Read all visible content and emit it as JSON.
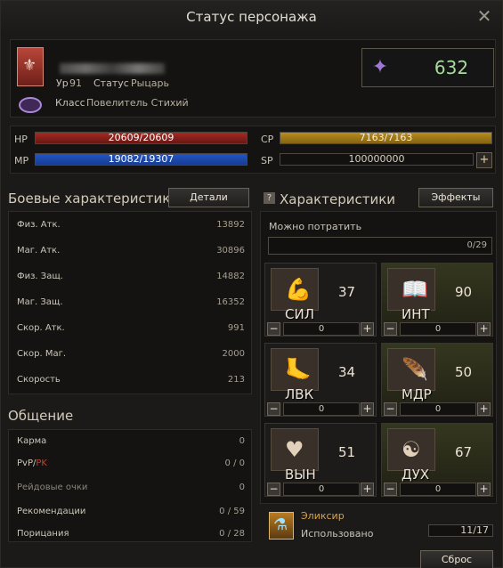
{
  "window": {
    "title": "Статус персонажа"
  },
  "profile": {
    "level_label": "Ур",
    "level_value": "91",
    "status_label": "Статус",
    "status_value": "Рыцарь",
    "class_label": "Класс",
    "class_value": "Повелитель Стихий",
    "cp_power": "632"
  },
  "bars": {
    "hp_label": "HP",
    "hp_value": "20609/20609",
    "mp_label": "MP",
    "mp_value": "19082/19307",
    "cp_label": "CP",
    "cp_value": "7163/7163",
    "sp_label": "SP",
    "sp_value": "100000000"
  },
  "combat": {
    "title": "Боевые характеристики",
    "details_button": "Детали",
    "rows": [
      {
        "name": "Физ. Атк.",
        "value": "13892"
      },
      {
        "name": "Маг. Атк.",
        "value": "30896"
      },
      {
        "name": "Физ. Защ.",
        "value": "14882"
      },
      {
        "name": "Маг. Защ.",
        "value": "16352"
      },
      {
        "name": "Скор. Атк.",
        "value": "991"
      },
      {
        "name": "Скор. Маг.",
        "value": "2000"
      },
      {
        "name": "Скорость",
        "value": "213"
      }
    ]
  },
  "social": {
    "title": "Общение",
    "karma_label": "Карма",
    "karma_value": "0",
    "pvp_label": "PvP/",
    "pk_label": "PK",
    "pvp_value": "0 / 0",
    "raid_label": "Рейдовые очки",
    "raid_value": "0",
    "recommend_label": "Рекомендации",
    "recommend_value": "0 / 59",
    "censure_label": "Порицания",
    "censure_value": "0 / 28"
  },
  "characteristics": {
    "title": "Характеристики",
    "effects_button": "Эффекты",
    "spend_label": "Можно потратить",
    "spend_value": "0/29",
    "stats": [
      {
        "name": "СИЛ",
        "value": "37",
        "input": "0",
        "icon": "arm"
      },
      {
        "name": "ИНТ",
        "value": "90",
        "input": "0",
        "icon": "book"
      },
      {
        "name": "ЛВК",
        "value": "34",
        "input": "0",
        "icon": "foot"
      },
      {
        "name": "МДР",
        "value": "50",
        "input": "0",
        "icon": "feather"
      },
      {
        "name": "ВЫН",
        "value": "51",
        "input": "0",
        "icon": "heart"
      },
      {
        "name": "ДУХ",
        "value": "67",
        "input": "0",
        "icon": "mask"
      }
    ]
  },
  "elixir": {
    "title": "Эликсир",
    "used_label": "Использовано",
    "used_value": "11/17",
    "reset_button": "Сброс"
  }
}
